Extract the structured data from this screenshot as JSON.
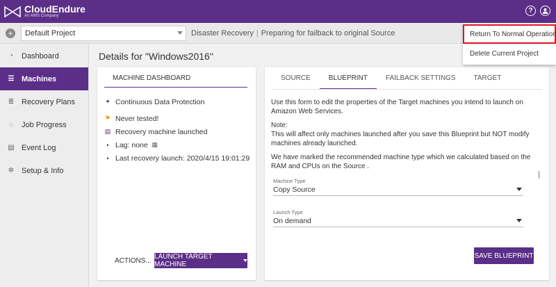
{
  "brand": {
    "name": "CloudEndure",
    "subtitle": "An AWS Company"
  },
  "topbar": {
    "help_icon": "question-icon",
    "user_icon": "user-icon",
    "help_glyph": "?"
  },
  "subheader": {
    "add_glyph": "+",
    "project": "Default Project",
    "mode": "Disaster Recovery",
    "separator": "|",
    "status": "Preparing for failback to original Source"
  },
  "sidebar": {
    "items": [
      {
        "label": "Dashboard",
        "icon": "dashboard-icon",
        "glyph": "◔"
      },
      {
        "label": "Machines",
        "icon": "list-icon",
        "glyph": "☰"
      },
      {
        "label": "Recovery Plans",
        "icon": "checklist-icon",
        "glyph": "≣"
      },
      {
        "label": "Job Progress",
        "icon": "progress-icon",
        "glyph": "◌"
      },
      {
        "label": "Event Log",
        "icon": "log-icon",
        "glyph": "▤"
      },
      {
        "label": "Setup & Info",
        "icon": "gear-icon",
        "glyph": "✲"
      }
    ]
  },
  "main": {
    "title": "Details for \"Windows2016\"",
    "left_card": {
      "tab": "MACHINE DASHBOARD",
      "statuses": [
        {
          "text": "Continuous Data Protection",
          "icon": "rocket-icon",
          "glyph": "✦"
        },
        {
          "text": "Never tested!",
          "icon": "flag-icon",
          "glyph": "⚑"
        },
        {
          "text": "Recovery machine launched",
          "icon": "document-icon",
          "glyph": "▤"
        },
        {
          "text": "Lag: none",
          "icon": "calendar-icon",
          "glyph": "▦"
        },
        {
          "text": "Last recovery launch: 2020/4/15 19:01:29"
        }
      ],
      "actions": "ACTIONS...",
      "launch": "LAUNCH TARGET MACHINE"
    },
    "right_card": {
      "tabs": [
        "SOURCE",
        "BLUEPRINT",
        "FAILBACK SETTINGS",
        "TARGET"
      ],
      "active_tab": "BLUEPRINT",
      "intro": "Use this form to edit the properties of the Target machines you intend to launch on Amazon Web Services.",
      "note_title": "Note:",
      "note": "This will affect only machines launched after you save this Blueprint but NOT modify machines already launched.",
      "recommend": "We have marked the recommended machine type which we calculated based on the RAM and CPUs on the Source .",
      "machine_type_label": "Machine Type",
      "machine_type_value": "Copy Source",
      "launch_type_label": "Launch Type",
      "launch_type_value": "On demand",
      "save": "SAVE BLUEPRINT"
    }
  },
  "menu": {
    "items": [
      "Return To Normal Operation",
      "Delete Current Project"
    ]
  },
  "colors": {
    "brand": "#5b2e88",
    "highlight": "#e0141e",
    "warning": "#f09a1e"
  }
}
